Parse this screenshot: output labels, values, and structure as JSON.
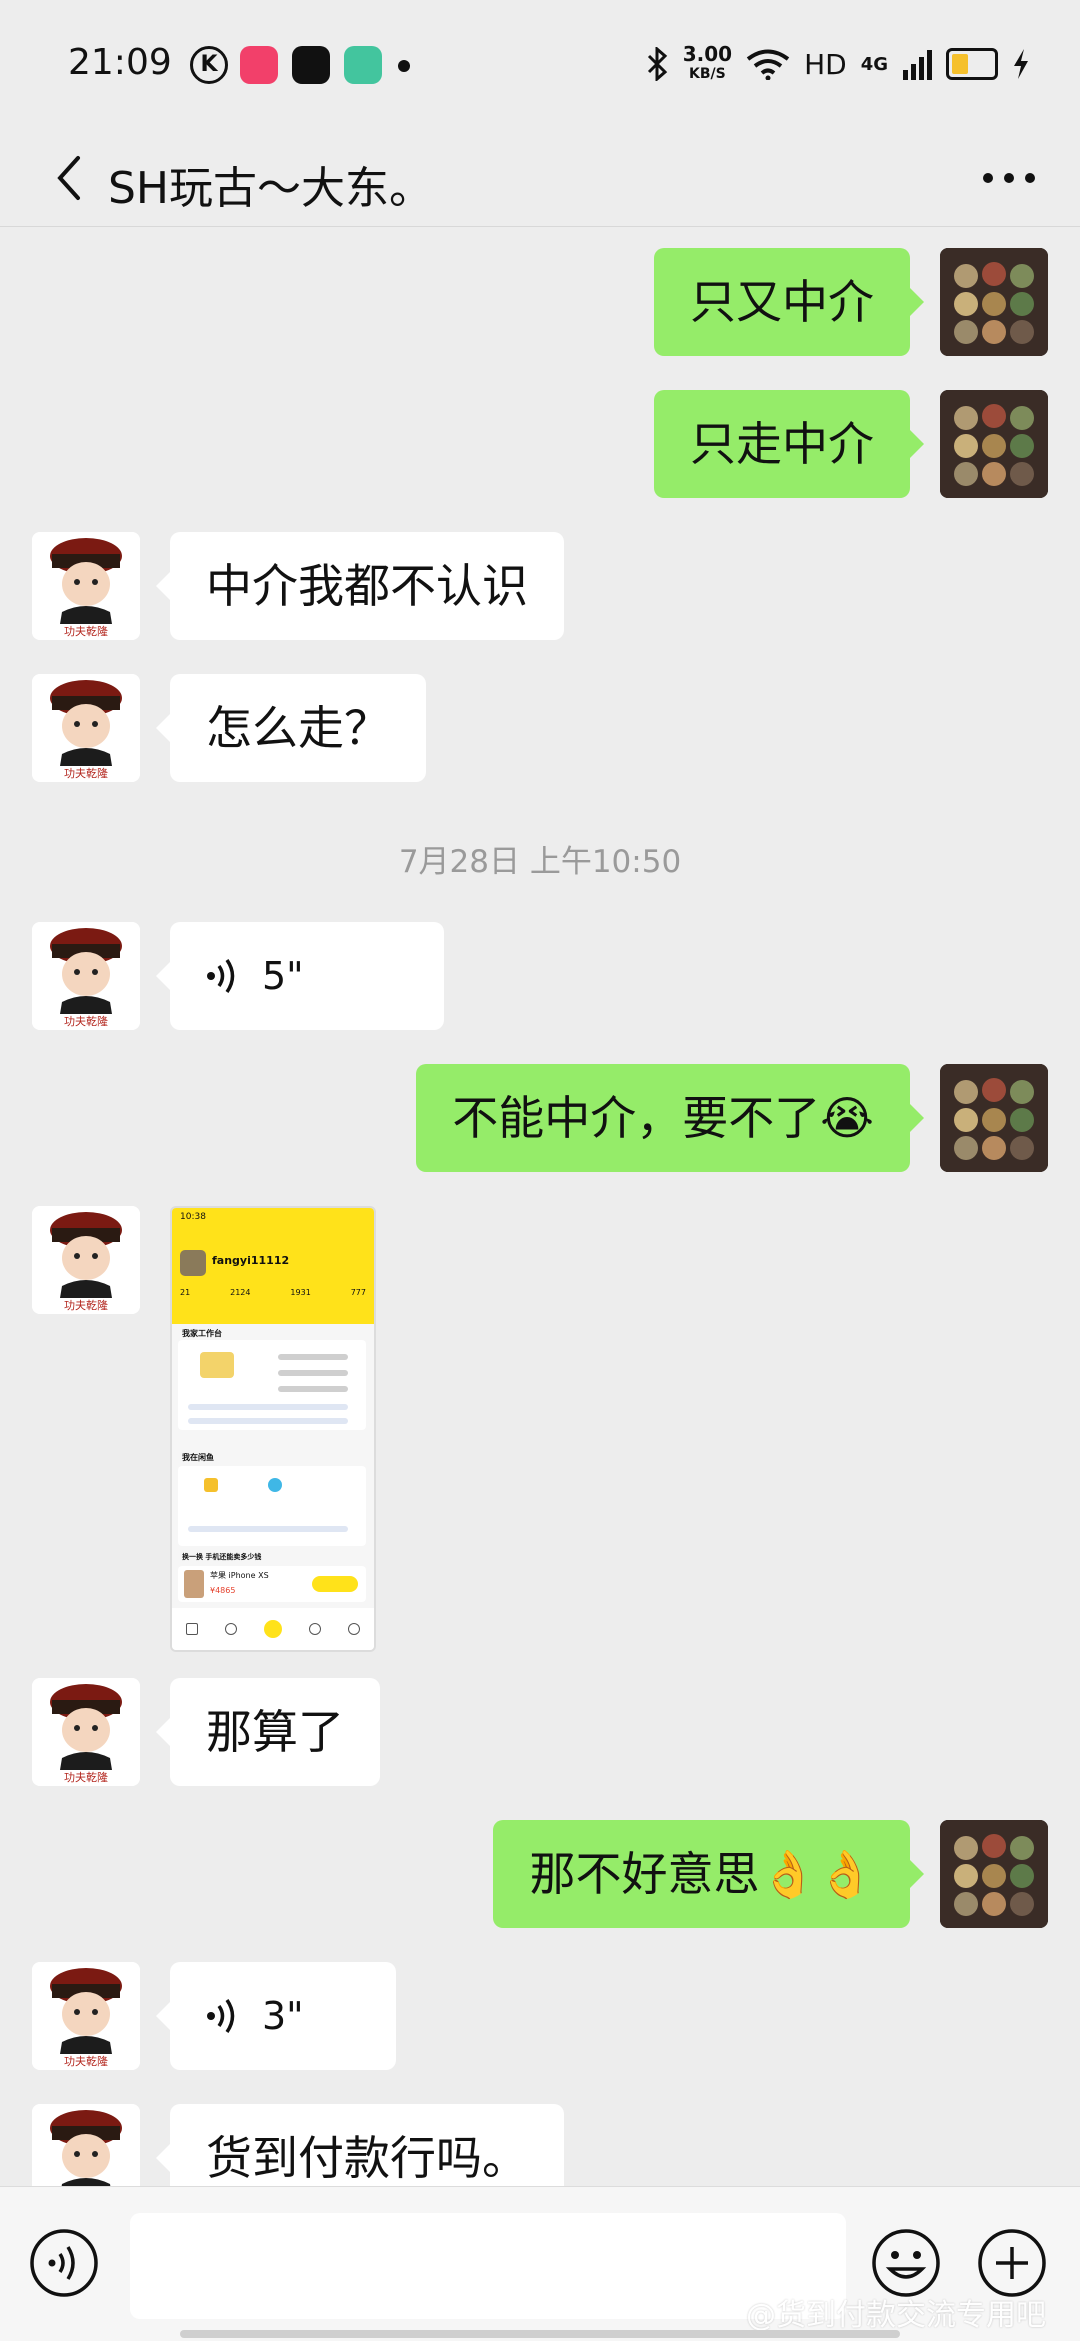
{
  "status_bar": {
    "time": "21:09",
    "speed_value": "3.00",
    "speed_unit": "KB/S",
    "hd": "HD",
    "network": "4G"
  },
  "header": {
    "title": "SH玩古～大东。"
  },
  "messages": [
    {
      "side": "out",
      "type": "text",
      "text": "只又中介"
    },
    {
      "side": "out",
      "type": "text",
      "text": "只走中介"
    },
    {
      "side": "in",
      "type": "text",
      "text": "中介我都不认识"
    },
    {
      "side": "in",
      "type": "text",
      "text": "怎么走？"
    },
    {
      "type": "timestamp",
      "text": "7月28日 上午10:50"
    },
    {
      "side": "in",
      "type": "voice",
      "text": "5\""
    },
    {
      "side": "out",
      "type": "text",
      "text": "不能中介，要不了😭"
    },
    {
      "side": "in",
      "type": "image",
      "caption": "fangyi11112"
    },
    {
      "side": "in",
      "type": "text",
      "text": "那算了"
    },
    {
      "side": "out",
      "type": "text",
      "text": "那不好意思👌👌"
    },
    {
      "side": "in",
      "type": "voice",
      "text": "3\""
    },
    {
      "side": "in",
      "type": "text",
      "text": "货到付款行吗。"
    }
  ],
  "screenshot_preview": {
    "time": "10:38",
    "user": "fangyi11112",
    "stats": [
      "21",
      "2124",
      "1931",
      "777"
    ],
    "section1": "我家工作台",
    "section2": "我在闲鱼",
    "section3": "换一换 手机还能卖多少钱",
    "phone": "苹果 iPhone XS",
    "price": "¥4865"
  },
  "input_bar": {
    "placeholder": ""
  },
  "watermark": "@货到付款交流专用吧",
  "colors": {
    "outgoing_bubble": "#95ec69",
    "incoming_bubble": "#ffffff",
    "background": "#ededed"
  }
}
